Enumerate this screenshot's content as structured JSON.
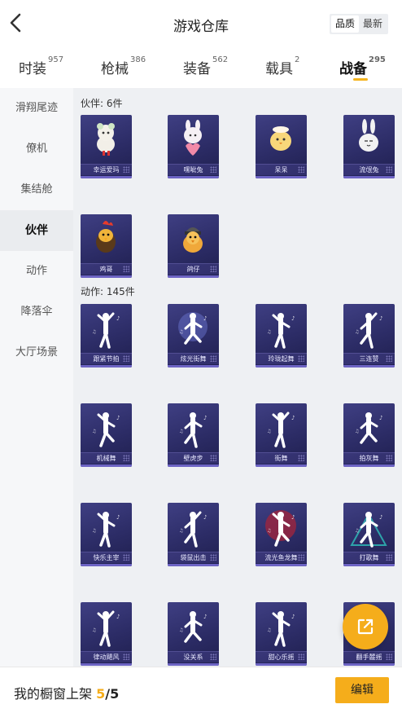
{
  "header": {
    "title": "游戏仓库",
    "sort": {
      "options": [
        "品质",
        "最新"
      ],
      "selected": "品质"
    }
  },
  "tabs": [
    {
      "label": "时装",
      "count": "957"
    },
    {
      "label": "枪械",
      "count": "386"
    },
    {
      "label": "装备",
      "count": "562"
    },
    {
      "label": "载具",
      "count": "2"
    },
    {
      "label": "战备",
      "count": "295",
      "active": true
    }
  ],
  "sidebar": {
    "items": [
      {
        "label": "滑翔尾迹"
      },
      {
        "label": "僚机"
      },
      {
        "label": "集结舱"
      },
      {
        "label": "伙伴",
        "active": true
      },
      {
        "label": "动作"
      },
      {
        "label": "降落伞"
      },
      {
        "label": "大厅场景"
      }
    ]
  },
  "sections": {
    "partners": {
      "label": "伙伴: 6件",
      "items": [
        {
          "name": "幸运爱玛",
          "icon": "sheep-mascot"
        },
        {
          "name": "嘿呲兔",
          "icon": "bunny-heart"
        },
        {
          "name": "呆呆",
          "icon": "chick-mascot"
        },
        {
          "name": "流氓兔",
          "icon": "rabbit-mascot"
        },
        {
          "name": "鸡哥",
          "icon": "rooster-mascot"
        },
        {
          "name": "鸽仔",
          "icon": "pigeon-mascot"
        }
      ]
    },
    "actions": {
      "label": "动作: 145件",
      "items": [
        {
          "name": "跟紧节拍",
          "icon": "dancer-pose"
        },
        {
          "name": "炫光街舞",
          "icon": "dancer-glow"
        },
        {
          "name": "玲珑起舞",
          "icon": "dancer-spin"
        },
        {
          "name": "三连赞",
          "icon": "dancer-thumbs"
        },
        {
          "name": "机械舞",
          "icon": "dancer-robot"
        },
        {
          "name": "壁虎步",
          "icon": "dancer-step"
        },
        {
          "name": "街舞",
          "icon": "dancer-street"
        },
        {
          "name": "拍灰舞",
          "icon": "dancer-dust"
        },
        {
          "name": "快乐主宰",
          "icon": "dancer-leap"
        },
        {
          "name": "袋鼠出击",
          "icon": "dancer-kick"
        },
        {
          "name": "流光鱼龙舞",
          "icon": "dancer-red"
        },
        {
          "name": "打歌舞",
          "icon": "dancer-neon"
        },
        {
          "name": "律动飓风",
          "icon": "dancer-sway"
        },
        {
          "name": "没关系",
          "icon": "dancer-shrug"
        },
        {
          "name": "甜心乐摇",
          "icon": "dancer-sweet"
        },
        {
          "name": "翻手麓摇",
          "icon": "dancer-wave"
        }
      ]
    }
  },
  "footer": {
    "showcase_label": "我的橱窗上架",
    "current": "5",
    "total": "/5",
    "edit_label": "编辑"
  },
  "colors": {
    "accent": "#f5ad1b",
    "card_bg": "#2c2c66",
    "card_stripe": "#6d64c4"
  },
  "fab": {
    "icon": "share-external-icon"
  }
}
